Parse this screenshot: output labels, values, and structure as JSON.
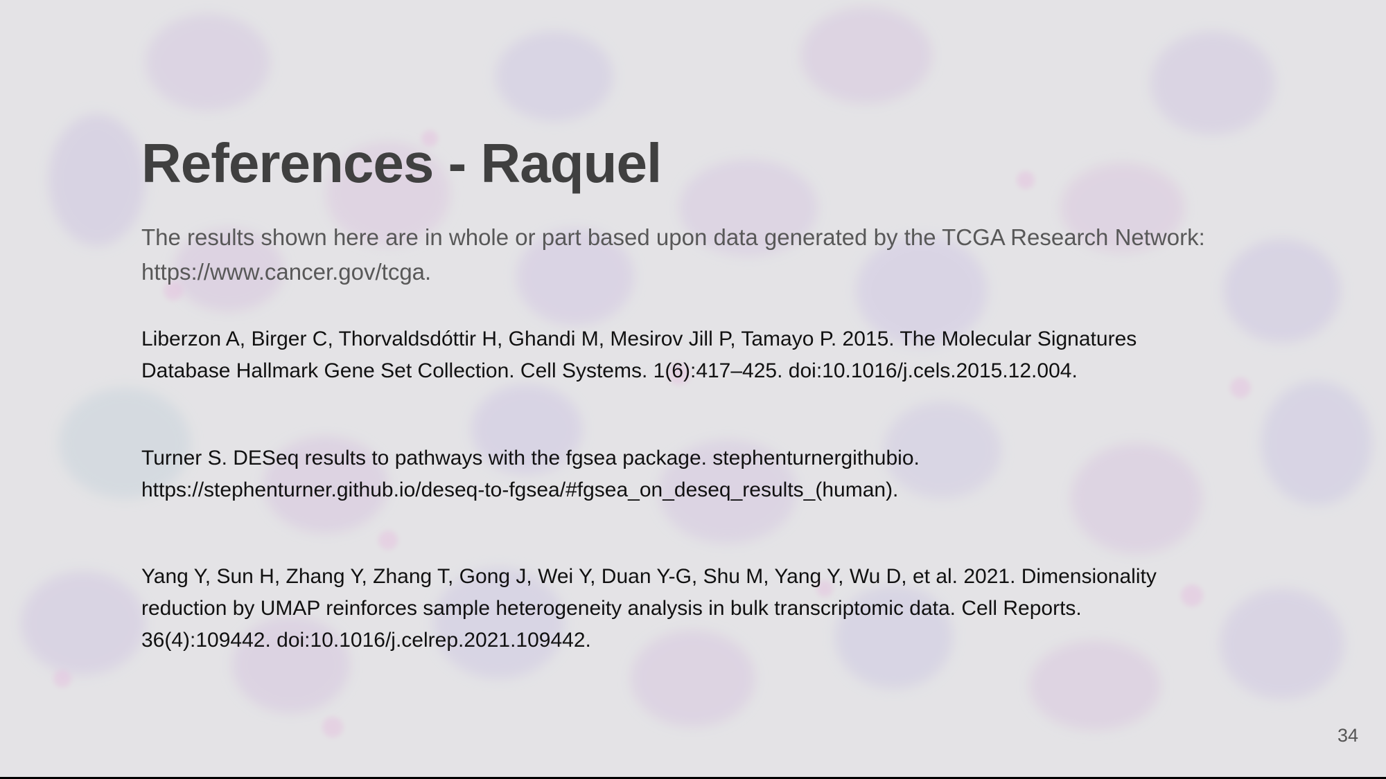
{
  "slide": {
    "title": "References - Raquel",
    "intro": {
      "line1": "The results shown here are in whole or part based upon data generated by the TCGA Research Network:",
      "line2": "https://www.cancer.gov/tcga."
    },
    "references": [
      {
        "line1": "Liberzon A, Birger C, Thorvaldsdóttir H, Ghandi M, Mesirov Jill P, Tamayo P. 2015. The Molecular Signatures",
        "line2": "Database Hallmark Gene Set Collection. Cell Systems. 1(6):417–425. doi:10.1016/j.cels.2015.12.004."
      },
      {
        "line1": "Turner S. DESeq results to pathways with the fgsea package. stephenturnergithubio.",
        "line2": "https://stephenturner.github.io/deseq-to-fgsea/#fgsea_on_deseq_results_(human)."
      },
      {
        "line1": "Yang Y, Sun H, Zhang Y, Zhang T, Gong J, Wei Y, Duan Y-G, Shu M, Yang Y, Wu D, et al. 2021. Dimensionality",
        "line2": "reduction by UMAP reinforces sample heterogeneity analysis in bulk transcriptomic data. Cell Reports.",
        "line3": "36(4):109442. doi:10.1016/j.celrep.2021.109442."
      }
    ],
    "page_number": "34"
  },
  "colors": {
    "background": "#e4e3e6",
    "title": "#404040",
    "intro_text": "#585858",
    "reference_text": "#111111",
    "cell_tint": "#c9a8e8"
  }
}
